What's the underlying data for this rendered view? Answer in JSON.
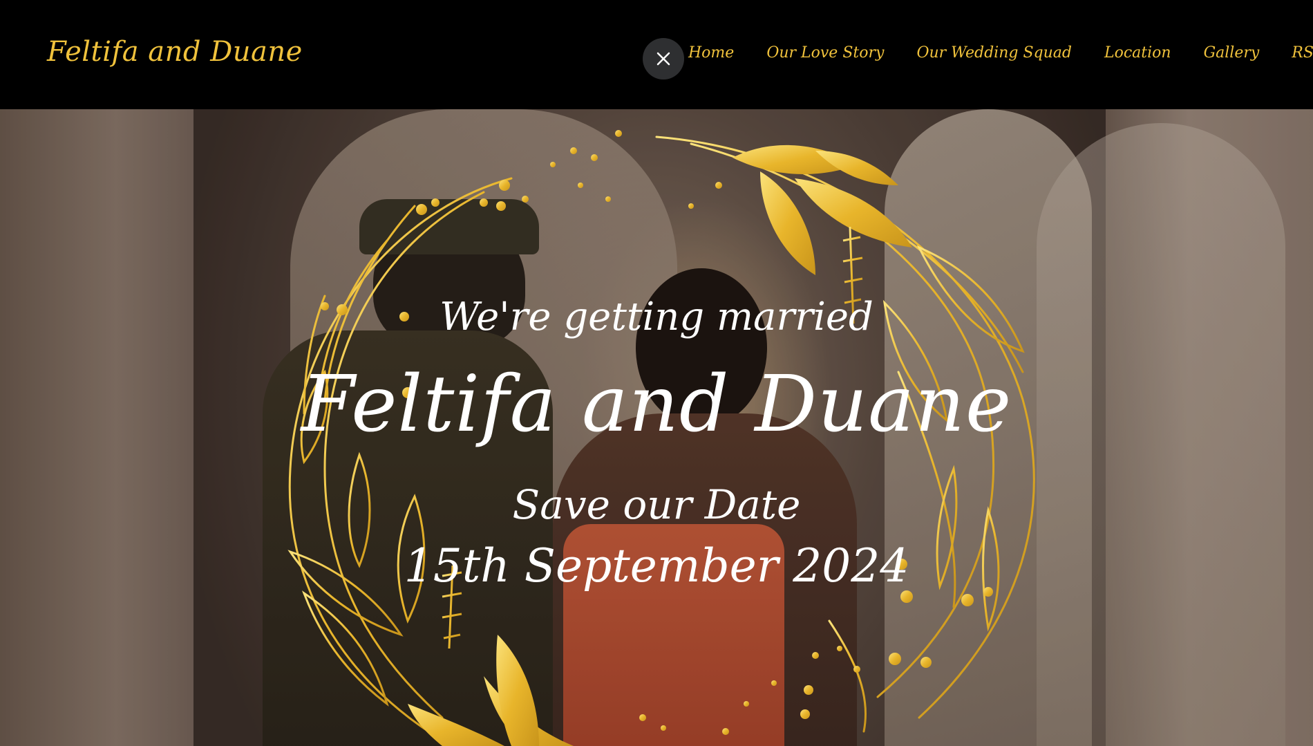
{
  "header": {
    "brand": "Feltifa and Duane",
    "close_label": "×"
  },
  "nav": {
    "items": [
      {
        "label": "Home"
      },
      {
        "label": "Our Love Story"
      },
      {
        "label": "Our Wedding Squad"
      },
      {
        "label": "Location"
      },
      {
        "label": "Gallery"
      },
      {
        "label": "RSVP"
      }
    ]
  },
  "hero": {
    "tagline": "We're getting married",
    "names": "Feltifa and Duane",
    "save_text": "Save our Date",
    "date": "15th September 2024"
  },
  "colors": {
    "accent_gold": "#f0c23c",
    "nav_bg": "#000000",
    "close_bg": "#2e2f31",
    "text_white": "#ffffff"
  },
  "icons": {
    "close": "close-icon",
    "wreath": "golden-leaf-wreath"
  }
}
